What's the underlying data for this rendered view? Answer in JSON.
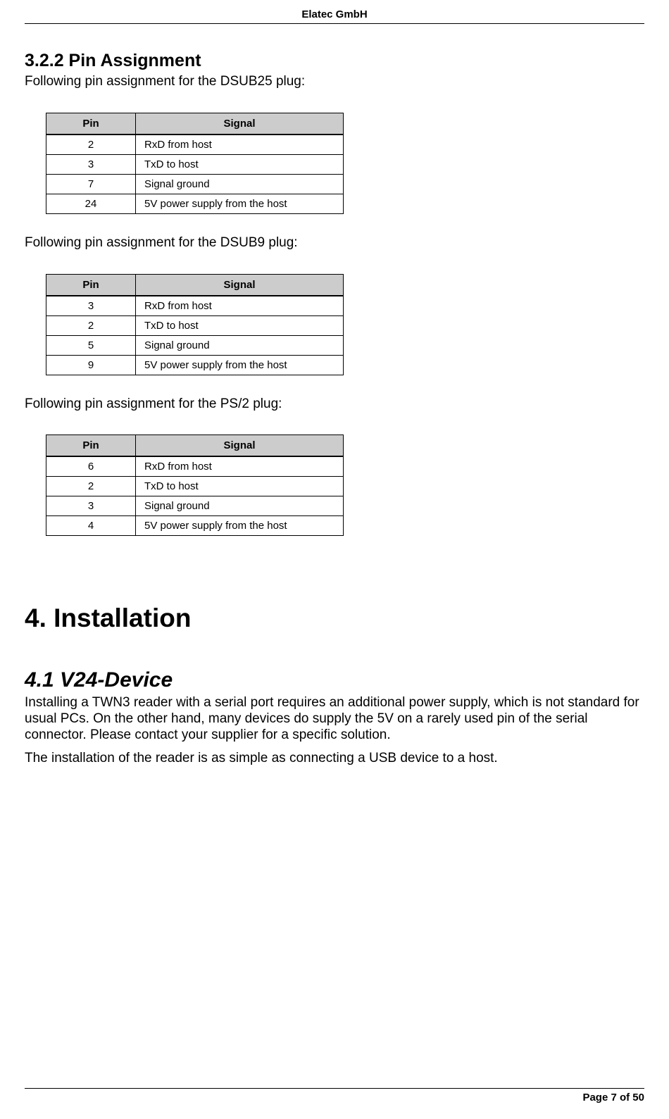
{
  "header": {
    "company": "Elatec GmbH"
  },
  "section_3_2_2": {
    "heading": "3.2.2  Pin Assignment",
    "intro_dsub25": "Following pin assignment for the DSUB25 plug:",
    "intro_dsub9": "Following pin assignment for the DSUB9 plug:",
    "intro_ps2": "Following pin assignment for the PS/2 plug:",
    "col_pin": "Pin",
    "col_signal": "Signal",
    "table_dsub25": [
      {
        "pin": "2",
        "signal": "RxD from host"
      },
      {
        "pin": "3",
        "signal": "TxD to host"
      },
      {
        "pin": "7",
        "signal": "Signal ground"
      },
      {
        "pin": "24",
        "signal": "5V power supply from the host"
      }
    ],
    "table_dsub9": [
      {
        "pin": "3",
        "signal": "RxD from host"
      },
      {
        "pin": "2",
        "signal": "TxD to host"
      },
      {
        "pin": "5",
        "signal": "Signal ground"
      },
      {
        "pin": "9",
        "signal": "5V power supply from the host"
      }
    ],
    "table_ps2": [
      {
        "pin": "6",
        "signal": "RxD from host"
      },
      {
        "pin": "2",
        "signal": "TxD to host"
      },
      {
        "pin": "3",
        "signal": "Signal ground"
      },
      {
        "pin": "4",
        "signal": "5V power supply from the host"
      }
    ]
  },
  "section_4": {
    "heading": "4. Installation"
  },
  "section_4_1": {
    "heading": "4.1  V24-Device",
    "para1": "Installing a TWN3 reader with a serial port requires an additional power supply, which is not standard for usual PCs. On the other hand, many devices do supply the 5V on a rarely used pin of the serial connector. Please contact your supplier for a specific solution.",
    "para2": "The installation of the reader is as simple as connecting a USB device to a host."
  },
  "footer": {
    "page": "Page 7 of 50"
  }
}
